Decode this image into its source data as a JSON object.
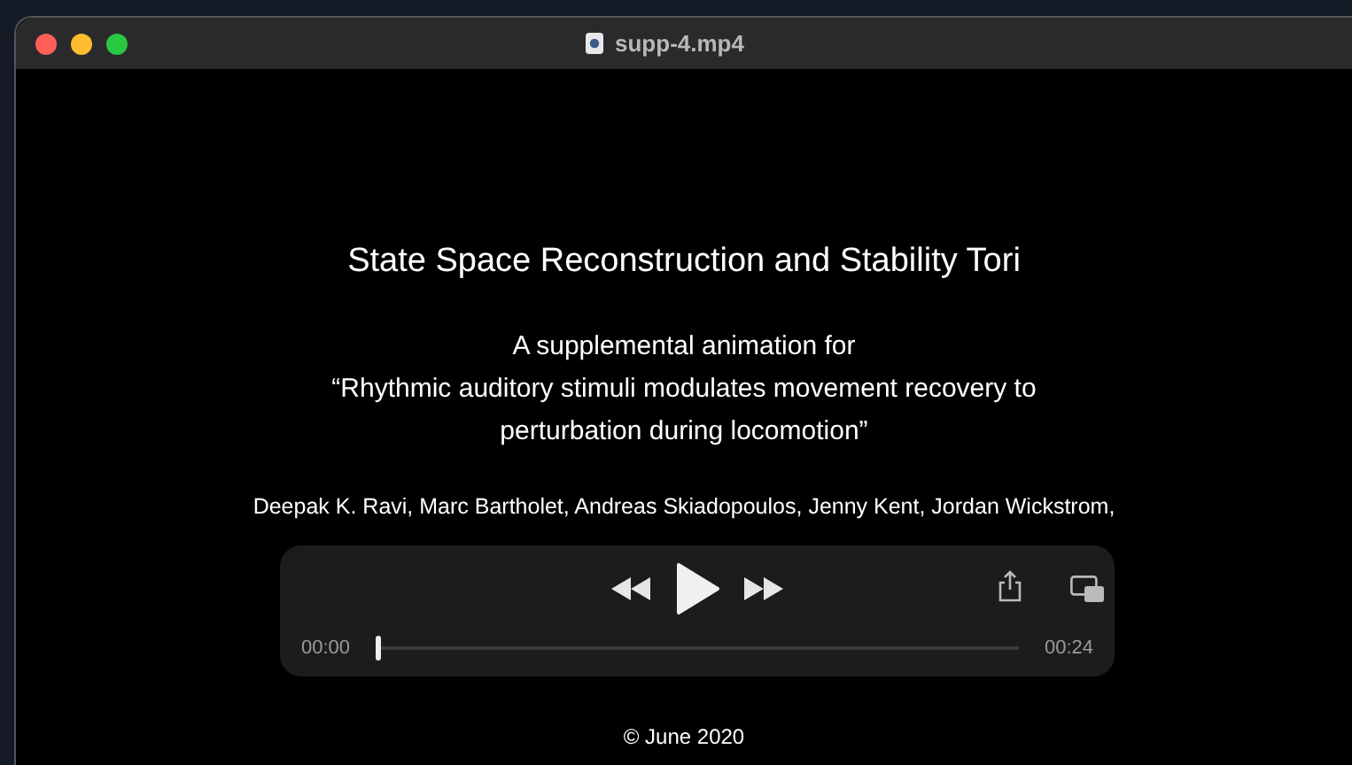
{
  "window": {
    "title": "supp-4.mp4"
  },
  "slide": {
    "title": "State Space Reconstruction and Stability Tori",
    "subtitle_lines": [
      "A supplemental animation for",
      "“Rhythmic auditory stimuli modulates movement recovery to",
      "perturbation during locomotion”"
    ],
    "authors": "Deepak K. Ravi, Marc Bartholet, Andreas Skiadopoulos, Jenny Kent, Jordan Wickstrom,",
    "footer": "© June 2020"
  },
  "player": {
    "elapsed": "00:00",
    "duration": "00:24",
    "level": 0
  }
}
